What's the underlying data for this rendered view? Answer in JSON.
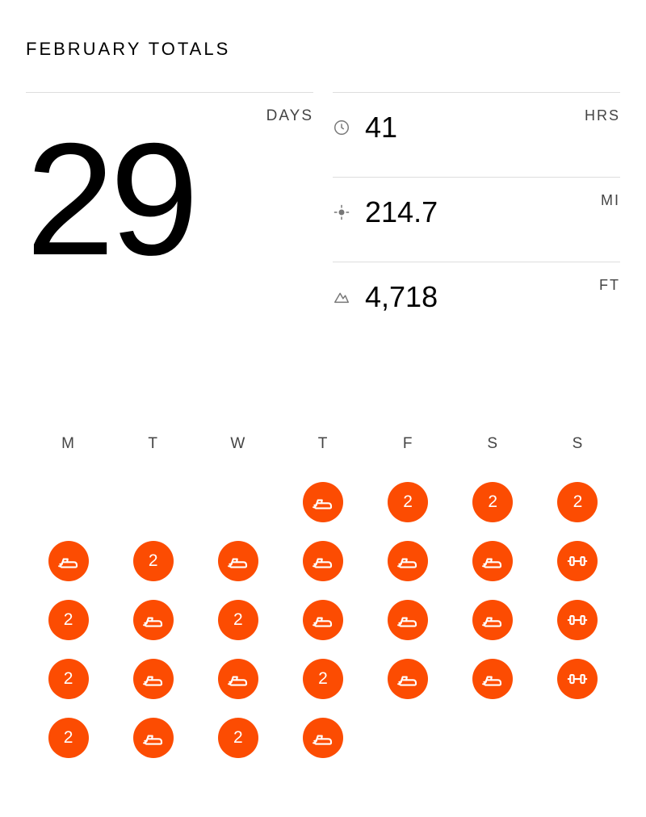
{
  "title": "FEBRUARY TOTALS",
  "colors": {
    "accent": "#fc4c02"
  },
  "days": {
    "label": "DAYS",
    "value": "29"
  },
  "metrics": [
    {
      "icon": "clock-icon",
      "value": "41",
      "unit": "HRS"
    },
    {
      "icon": "target-icon",
      "value": "214.7",
      "unit": "MI"
    },
    {
      "icon": "mountain-icon",
      "value": "4,718",
      "unit": "FT"
    }
  ],
  "calendar": {
    "headers": [
      "M",
      "T",
      "W",
      "T",
      "F",
      "S",
      "S"
    ],
    "rows": [
      [
        null,
        null,
        null,
        {
          "type": "run"
        },
        {
          "type": "count",
          "n": "2"
        },
        {
          "type": "count",
          "n": "2"
        },
        {
          "type": "count",
          "n": "2"
        }
      ],
      [
        {
          "type": "run"
        },
        {
          "type": "count",
          "n": "2"
        },
        {
          "type": "run"
        },
        {
          "type": "run"
        },
        {
          "type": "run"
        },
        {
          "type": "run"
        },
        {
          "type": "weight"
        }
      ],
      [
        {
          "type": "count",
          "n": "2"
        },
        {
          "type": "run"
        },
        {
          "type": "count",
          "n": "2"
        },
        {
          "type": "run"
        },
        {
          "type": "run"
        },
        {
          "type": "run"
        },
        {
          "type": "weight"
        }
      ],
      [
        {
          "type": "count",
          "n": "2"
        },
        {
          "type": "run"
        },
        {
          "type": "run"
        },
        {
          "type": "count",
          "n": "2"
        },
        {
          "type": "run"
        },
        {
          "type": "run"
        },
        {
          "type": "weight"
        }
      ],
      [
        {
          "type": "count",
          "n": "2"
        },
        {
          "type": "run"
        },
        {
          "type": "count",
          "n": "2"
        },
        {
          "type": "run"
        },
        null,
        null,
        null
      ]
    ]
  }
}
